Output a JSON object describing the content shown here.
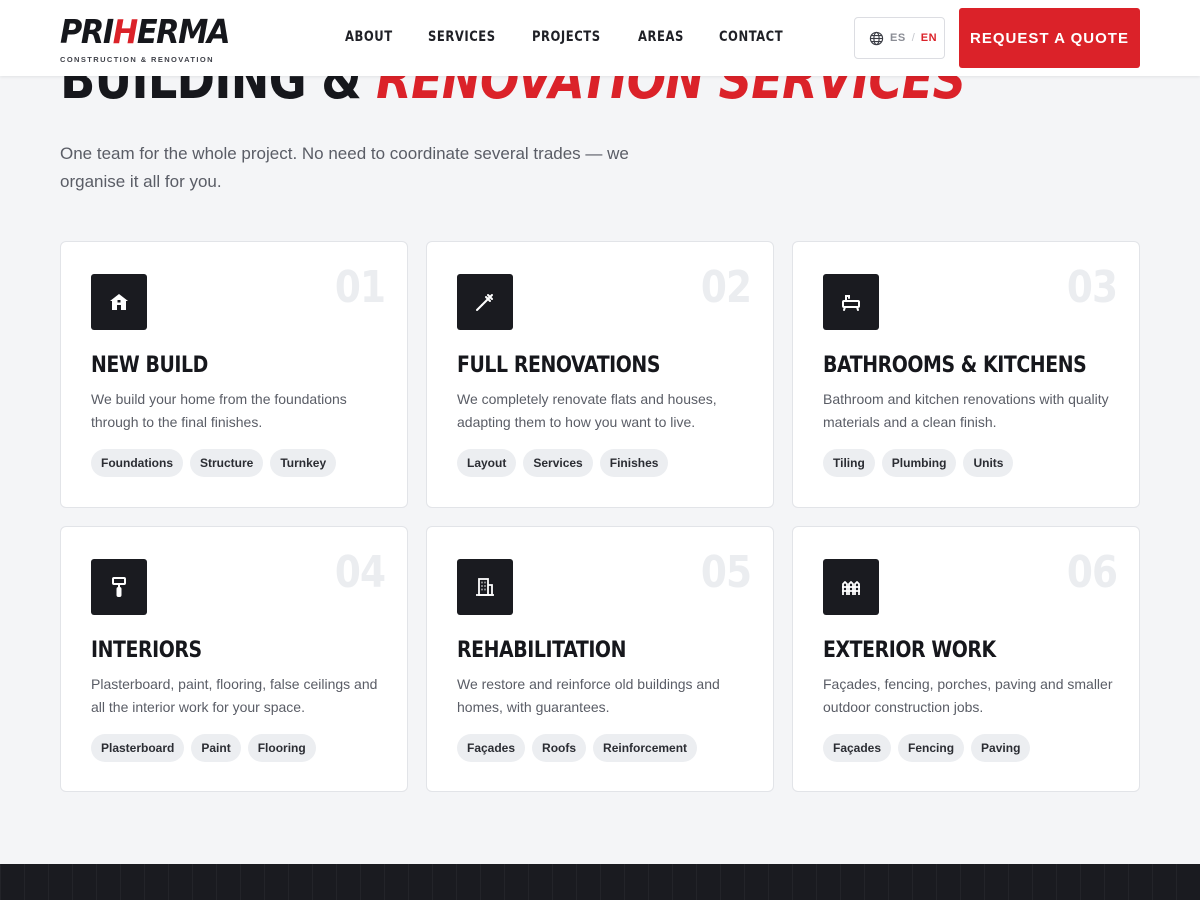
{
  "brand": {
    "logo_prefix": "PRI",
    "logo_accent": "H",
    "logo_suffix": "ERMA",
    "tagline": "CONSTRUCTION & RENOVATION",
    "accent_color": "#db2229",
    "dark_color": "#1a1b20"
  },
  "nav": {
    "items": [
      {
        "label": "ABOUT"
      },
      {
        "label": "SERVICES"
      },
      {
        "label": "PROJECTS"
      },
      {
        "label": "AREAS"
      },
      {
        "label": "CONTACT"
      }
    ]
  },
  "lang": {
    "icon": "globe-icon",
    "options": [
      "ES",
      "EN"
    ],
    "separator": "/",
    "active": "EN"
  },
  "cta": {
    "label": "REQUEST A QUOTE"
  },
  "hero": {
    "title_plain": "BUILDING & ",
    "title_accent": "RENOVATION SERVICES",
    "subtitle": "One team for the whole project. No need to coordinate several trades — we organise it all for you."
  },
  "services": [
    {
      "number": "01",
      "icon": "house-icon",
      "title": "NEW BUILD",
      "description": "We build your home from the foundations through to the final finishes.",
      "tags": [
        "Foundations",
        "Structure",
        "Turnkey"
      ]
    },
    {
      "number": "02",
      "icon": "trowel-icon",
      "title": "FULL RENOVATIONS",
      "description": "We completely renovate flats and houses, adapting them to how you want to live.",
      "tags": [
        "Layout",
        "Services",
        "Finishes"
      ]
    },
    {
      "number": "03",
      "icon": "bathtub-icon",
      "title": "BATHROOMS & KITCHENS",
      "description": "Bathroom and kitchen renovations with quality materials and a clean finish.",
      "tags": [
        "Tiling",
        "Plumbing",
        "Units"
      ]
    },
    {
      "number": "04",
      "icon": "paint-roller-icon",
      "title": "INTERIORS",
      "description": "Plasterboard, paint, flooring, false ceilings and all the interior work for your space.",
      "tags": [
        "Plasterboard",
        "Paint",
        "Flooring"
      ]
    },
    {
      "number": "05",
      "icon": "building-icon",
      "title": "REHABILITATION",
      "description": "We restore and reinforce old buildings and homes, with guarantees.",
      "tags": [
        "Façades",
        "Roofs",
        "Reinforcement"
      ]
    },
    {
      "number": "06",
      "icon": "fence-icon",
      "title": "EXTERIOR WORK",
      "description": "Façades, fencing, porches, paving and smaller outdoor construction jobs.",
      "tags": [
        "Façades",
        "Fencing",
        "Paving"
      ]
    }
  ]
}
